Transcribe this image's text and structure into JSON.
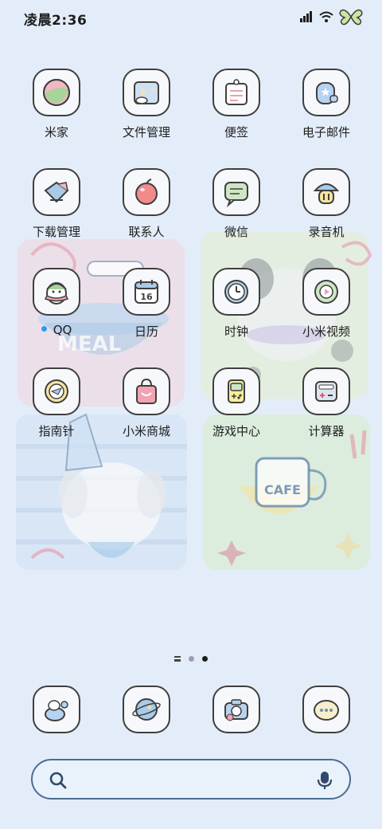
{
  "status_bar": {
    "time": "凌晨2:36",
    "icons": [
      "hd-signal-icon",
      "wifi-icon",
      "butterfly-battery-icon"
    ]
  },
  "home": {
    "apps": [
      {
        "label": "米家",
        "icon": "mijia-icon"
      },
      {
        "label": "文件管理",
        "icon": "file-manager-icon"
      },
      {
        "label": "便签",
        "icon": "notes-icon"
      },
      {
        "label": "电子邮件",
        "icon": "email-icon"
      },
      {
        "label": "下载管理",
        "icon": "download-icon"
      },
      {
        "label": "联系人",
        "icon": "contacts-icon"
      },
      {
        "label": "微信",
        "icon": "wechat-icon"
      },
      {
        "label": "录音机",
        "icon": "recorder-icon"
      },
      {
        "label": "QQ",
        "icon": "qq-icon",
        "badge": "new"
      },
      {
        "label": "日历",
        "icon": "calendar-icon",
        "calendar_day": "16"
      },
      {
        "label": "时钟",
        "icon": "clock-icon"
      },
      {
        "label": "小米视频",
        "icon": "video-icon"
      },
      {
        "label": "指南针",
        "icon": "compass-icon"
      },
      {
        "label": "小米商城",
        "icon": "mall-icon"
      },
      {
        "label": "游戏中心",
        "icon": "game-center-icon"
      },
      {
        "label": "计算器",
        "icon": "calculator-icon"
      }
    ],
    "wallpaper_text": {
      "meal": "MEAL",
      "cafe": "CAFE"
    }
  },
  "pager": {
    "pages": 2,
    "current": 2
  },
  "dock": {
    "apps": [
      {
        "icon": "phone-icon"
      },
      {
        "icon": "browser-icon"
      },
      {
        "icon": "camera-icon"
      },
      {
        "icon": "messages-icon"
      }
    ]
  },
  "search": {
    "placeholder": ""
  },
  "colors": {
    "background": "#e3edf9",
    "tile_border": "#3f3f3f",
    "search_border": "#4d6d90",
    "badge": "#2e9bf0"
  }
}
